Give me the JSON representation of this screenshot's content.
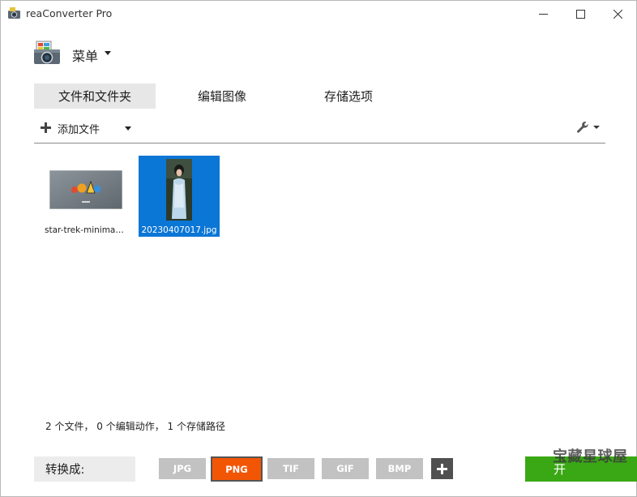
{
  "window": {
    "title": "reaConverter Pro"
  },
  "menu": {
    "label": "菜单"
  },
  "tabs": [
    {
      "label": "文件和文件夹",
      "active": true
    },
    {
      "label": "编辑图像",
      "active": false
    },
    {
      "label": "存储选项",
      "active": false
    }
  ],
  "toolbar": {
    "add_files_label": "添加文件"
  },
  "files": [
    {
      "name": "star-trek-minimalis...",
      "selected": false
    },
    {
      "name": "20230407017.jpg",
      "selected": true
    }
  ],
  "status": {
    "text": "2 个文件， 0 个编辑动作， 1 个存储路径"
  },
  "convert": {
    "label": "转换成:",
    "formats": [
      {
        "label": "JPG",
        "selected": false
      },
      {
        "label": "PNG",
        "selected": true
      },
      {
        "label": "TIF",
        "selected": false
      },
      {
        "label": "GIF",
        "selected": false
      },
      {
        "label": "BMP",
        "selected": false
      }
    ]
  },
  "start_button": {
    "label": "开"
  },
  "watermark": {
    "text": "宝藏星球屋"
  },
  "colors": {
    "accent_selected_format": "#f25605",
    "selection_blue": "#0a76d6",
    "start_green": "#3aa815",
    "inactive_format": "#c2c2c2"
  },
  "icons": {
    "app": "camera-icon",
    "menu": "camera-icon",
    "add": "plus-icon",
    "settings": "wrench-icon",
    "add_format": "plus-icon"
  }
}
